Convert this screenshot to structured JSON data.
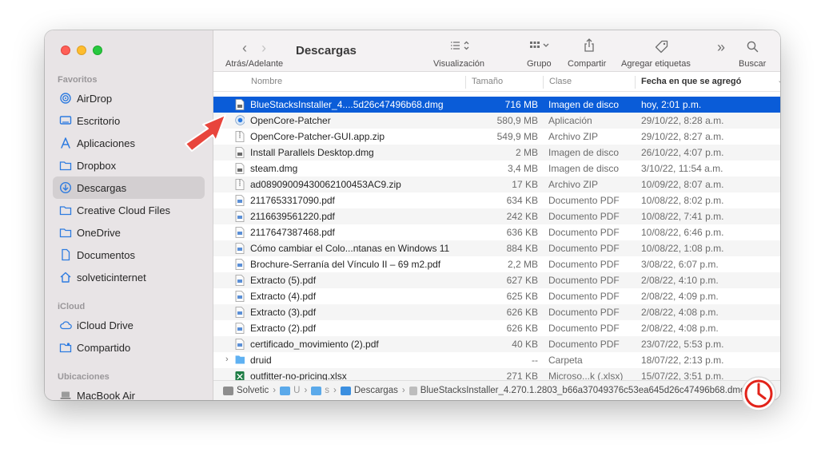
{
  "sidebar": {
    "sections": [
      {
        "label": "Favoritos"
      },
      {
        "label": "iCloud"
      },
      {
        "label": "Ubicaciones"
      }
    ],
    "items": [
      {
        "label": "AirDrop",
        "icon": "airdrop-icon"
      },
      {
        "label": "Escritorio",
        "icon": "desktop-icon"
      },
      {
        "label": "Aplicaciones",
        "icon": "applications-icon"
      },
      {
        "label": "Dropbox",
        "icon": "folder-icon"
      },
      {
        "label": "Descargas",
        "icon": "downloads-icon",
        "active": true
      },
      {
        "label": "Creative Cloud Files",
        "icon": "folder-icon"
      },
      {
        "label": "OneDrive",
        "icon": "folder-icon"
      },
      {
        "label": "Documentos",
        "icon": "document-icon"
      },
      {
        "label": "solveticinternet",
        "icon": "home-icon"
      },
      {
        "label": "iCloud Drive",
        "icon": "cloud-icon"
      },
      {
        "label": "Compartido",
        "icon": "shared-folder-icon"
      },
      {
        "label": "MacBook Air",
        "icon": "laptop-icon"
      }
    ]
  },
  "toolbar": {
    "title": "Descargas",
    "nav_label": "Atrás/Adelante",
    "view_label": "Visualización",
    "group_label": "Grupo",
    "share_label": "Compartir",
    "tags_label": "Agregar etiquetas",
    "search_label": "Buscar"
  },
  "columns": {
    "name": "Nombre",
    "size": "Tamaño",
    "kind": "Clase",
    "date": "Fecha en que se agregó"
  },
  "files": [
    {
      "name": "BlueStacksInstaller_4....5d26c47496b68.dmg",
      "size": "716 MB",
      "kind": "Imagen de disco",
      "date": "hoy, 2:01 p.m.",
      "icon": "disk-image-icon"
    },
    {
      "name": "OpenCore-Patcher",
      "size": "580,9 MB",
      "kind": "Aplicación",
      "date": "29/10/22, 8:28 a.m.",
      "icon": "app-icon"
    },
    {
      "name": "OpenCore-Patcher-GUI.app.zip",
      "size": "549,9 MB",
      "kind": "Archivo ZIP",
      "date": "29/10/22, 8:27 a.m.",
      "icon": "zip-icon"
    },
    {
      "name": "Install Parallels Desktop.dmg",
      "size": "2 MB",
      "kind": "Imagen de disco",
      "date": "26/10/22, 4:07 p.m.",
      "icon": "disk-image-icon"
    },
    {
      "name": "steam.dmg",
      "size": "3,4 MB",
      "kind": "Imagen de disco",
      "date": "3/10/22, 11:54 a.m.",
      "icon": "disk-image-icon"
    },
    {
      "name": "ad08909009430062100453AC9.zip",
      "size": "17 KB",
      "kind": "Archivo ZIP",
      "date": "10/09/22, 8:07 a.m.",
      "icon": "zip-icon"
    },
    {
      "name": "2117653317090.pdf",
      "size": "634 KB",
      "kind": "Documento PDF",
      "date": "10/08/22, 8:02 p.m.",
      "icon": "pdf-icon"
    },
    {
      "name": "2116639561220.pdf",
      "size": "242 KB",
      "kind": "Documento PDF",
      "date": "10/08/22, 7:41 p.m.",
      "icon": "pdf-icon"
    },
    {
      "name": "2117647387468.pdf",
      "size": "636 KB",
      "kind": "Documento PDF",
      "date": "10/08/22, 6:46 p.m.",
      "icon": "pdf-icon"
    },
    {
      "name": "Cómo cambiar el Colo...ntanas en Windows 11",
      "size": "884 KB",
      "kind": "Documento PDF",
      "date": "10/08/22, 1:08 p.m.",
      "icon": "pdf-icon"
    },
    {
      "name": "Brochure-Serranía del Vínculo II – 69 m2.pdf",
      "size": "2,2 MB",
      "kind": "Documento PDF",
      "date": "3/08/22, 6:07 p.m.",
      "icon": "pdf-icon"
    },
    {
      "name": "Extracto (5).pdf",
      "size": "627 KB",
      "kind": "Documento PDF",
      "date": "2/08/22, 4:10 p.m.",
      "icon": "pdf-icon"
    },
    {
      "name": "Extracto (4).pdf",
      "size": "625 KB",
      "kind": "Documento PDF",
      "date": "2/08/22, 4:09 p.m.",
      "icon": "pdf-icon"
    },
    {
      "name": "Extracto (3).pdf",
      "size": "626 KB",
      "kind": "Documento PDF",
      "date": "2/08/22, 4:08 p.m.",
      "icon": "pdf-icon"
    },
    {
      "name": "Extracto (2).pdf",
      "size": "626 KB",
      "kind": "Documento PDF",
      "date": "2/08/22, 4:08 p.m.",
      "icon": "pdf-icon"
    },
    {
      "name": "certificado_movimiento (2).pdf",
      "size": "40 KB",
      "kind": "Documento PDF",
      "date": "23/07/22, 5:53 p.m.",
      "icon": "pdf-icon"
    },
    {
      "name": "druid",
      "size": "--",
      "kind": "Carpeta",
      "date": "18/07/22, 2:13 p.m.",
      "icon": "folder-icon"
    },
    {
      "name": "outfitter-no-pricing.xlsx",
      "size": "271 KB",
      "kind": "Microso...k (.xlsx)",
      "date": "15/07/22, 3:51 p.m.",
      "icon": "excel-icon"
    }
  ],
  "pathbar": {
    "items": [
      "Solvetic",
      "U",
      "s",
      "Descargas",
      "BlueStacksInstaller_4.270.1.2803_b66a37049376c53ea645d26c47496b68.dmg"
    ]
  },
  "colors": {
    "selection": "#0a5cd8",
    "sidebar_bg": "#e8e4e6",
    "accent_icon": "#2d7be0",
    "arrow": "#e8453c"
  }
}
